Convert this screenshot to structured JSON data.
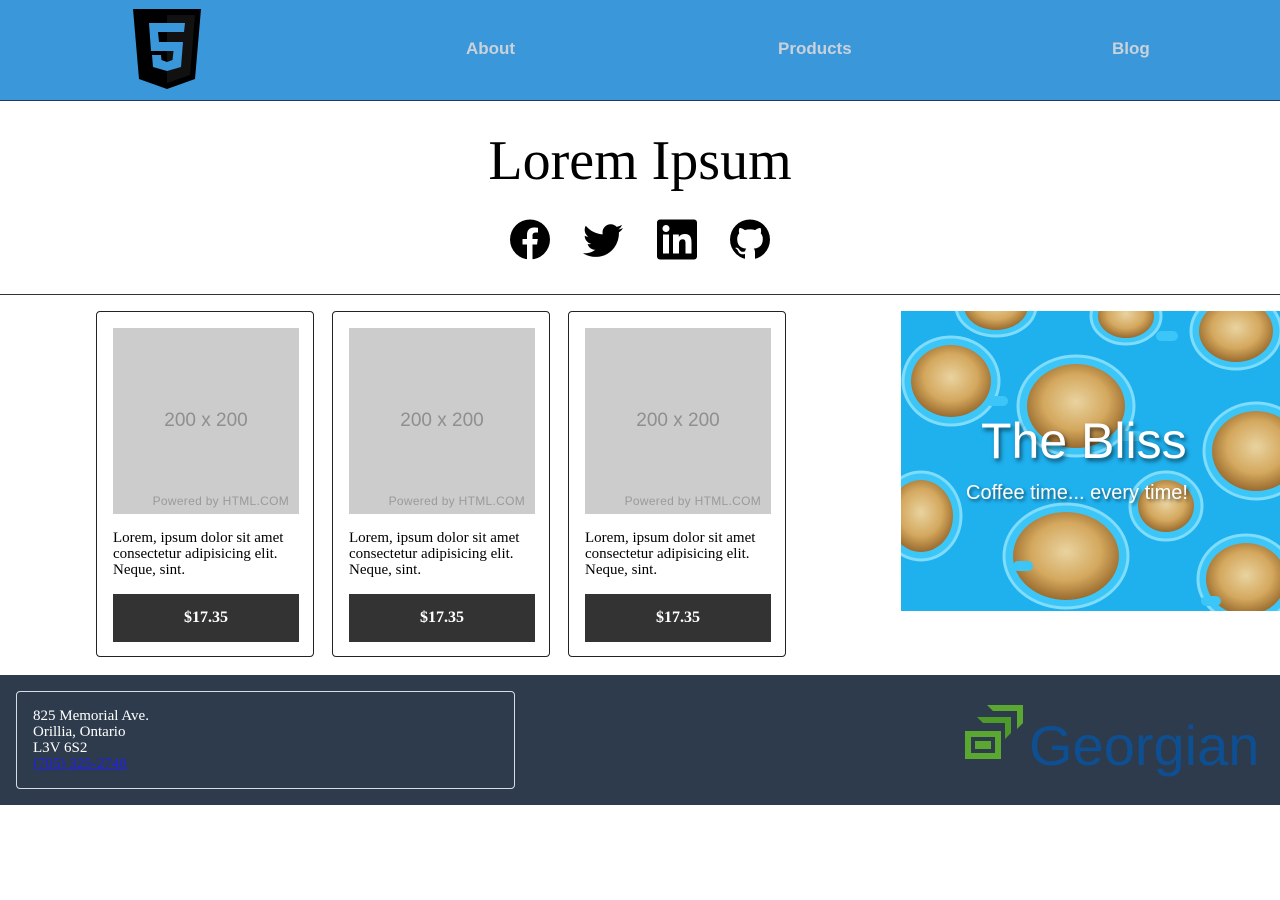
{
  "header": {
    "logo_icon": "html5-shield-icon",
    "nav": [
      {
        "label": "About"
      },
      {
        "label": "Products"
      },
      {
        "label": "Blog"
      }
    ],
    "bg_color": "#3a97da"
  },
  "hero": {
    "title": "Lorem Ipsum",
    "social_icons": [
      "facebook-icon",
      "twitter-icon",
      "linkedin-icon",
      "github-icon"
    ]
  },
  "cards": [
    {
      "image_label": "200 x 200",
      "image_credit": "Powered by HTML.COM",
      "text": "Lorem, ipsum dolor sit amet consectetur adipisicing elit. Neque, sint.",
      "price": "$17.35"
    },
    {
      "image_label": "200 x 200",
      "image_credit": "Powered by HTML.COM",
      "text": "Lorem, ipsum dolor sit amet consectetur adipisicing elit. Neque, sint.",
      "price": "$17.35"
    },
    {
      "image_label": "200 x 200",
      "image_credit": "Powered by HTML.COM",
      "text": "Lorem, ipsum dolor sit amet consectetur adipisicing elit. Neque, sint.",
      "price": "$17.35"
    }
  ],
  "banner": {
    "title": "The Bliss",
    "subtitle": "Coffee time... every time!"
  },
  "footer": {
    "address_lines": [
      "825 Memorial Ave.",
      "Orillia, Ontario",
      "L3V 6S2"
    ],
    "phone": "(705) 325-2740",
    "logo_text": "Georgian",
    "bg_color": "#2d3b4d"
  }
}
